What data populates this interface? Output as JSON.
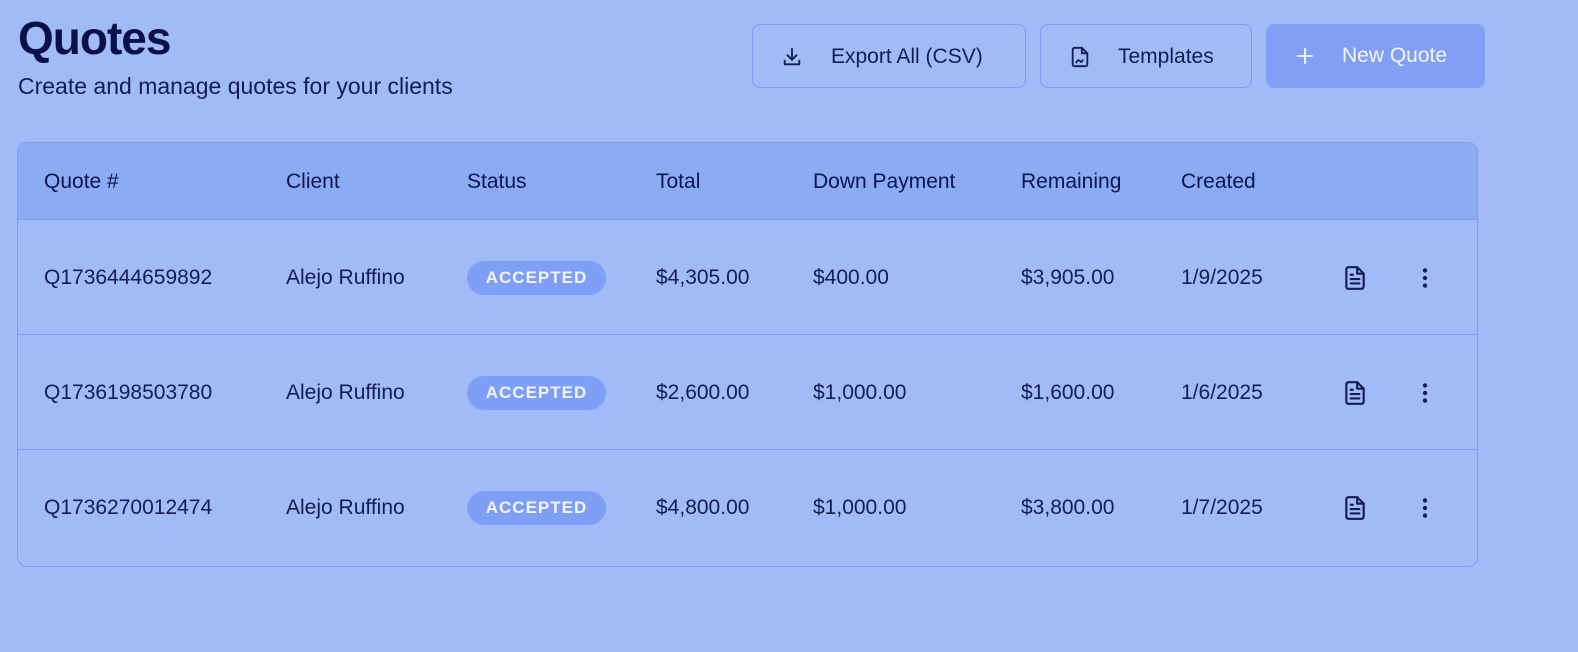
{
  "header": {
    "title": "Quotes",
    "subtitle": "Create and manage quotes for your clients"
  },
  "actions": {
    "export_label": "Export All (CSV)",
    "templates_label": "Templates",
    "new_quote_label": "New Quote"
  },
  "table": {
    "columns": [
      "Quote #",
      "Client",
      "Status",
      "Total",
      "Down Payment",
      "Remaining",
      "Created"
    ],
    "rows": [
      {
        "quote": "Q1736444659892",
        "client": "Alejo Ruffino",
        "status": "ACCEPTED",
        "total": "$4,305.00",
        "down_payment": "$400.00",
        "remaining": "$3,905.00",
        "created": "1/9/2025"
      },
      {
        "quote": "Q1736198503780",
        "client": "Alejo Ruffino",
        "status": "ACCEPTED",
        "total": "$2,600.00",
        "down_payment": "$1,000.00",
        "remaining": "$1,600.00",
        "created": "1/6/2025"
      },
      {
        "quote": "Q1736270012474",
        "client": "Alejo Ruffino",
        "status": "ACCEPTED",
        "total": "$4,800.00",
        "down_payment": "$1,000.00",
        "remaining": "$3,800.00",
        "created": "1/7/2025"
      }
    ]
  },
  "icons": {
    "export": "download-icon",
    "templates": "file-signature-icon",
    "new_quote": "plus-icon",
    "row_document": "document-icon",
    "row_menu": "more-vertical-icon"
  },
  "colors": {
    "background": "#a1bbf9",
    "header_row": "#8cabf5",
    "primary_button": "#829ff5",
    "badge": "#7e9ff5",
    "text": "#0c1550"
  }
}
